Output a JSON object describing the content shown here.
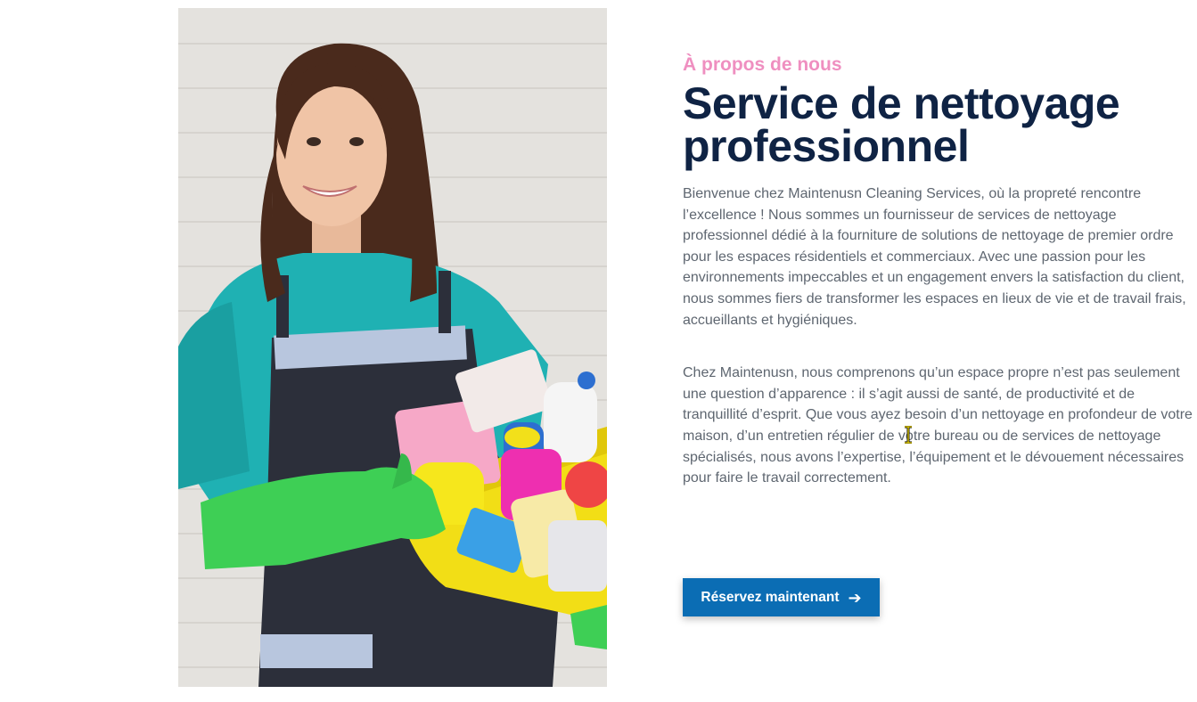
{
  "photo": {
    "alt_icon": "cleaning-lady-photo"
  },
  "about": {
    "eyebrow": "À propos de nous",
    "title_line1": "Service de nettoyage",
    "title_line2": "professionnel",
    "paragraph1": "Bienvenue chez Maintenusn Cleaning Services, où la propreté rencontre l’excellence ! Nous sommes un fournisseur de services de nettoyage professionnel dédié à la fourniture de solutions de nettoyage de premier ordre pour les espaces résidentiels et commerciaux. Avec une passion pour les environnements impeccables et un engagement envers la satisfaction du client, nous sommes fiers de transformer les espaces en lieux de vie et de travail frais, accueillants et hygiéniques.",
    "paragraph2": "Chez Maintenusn, nous comprenons qu’un espace propre n’est pas seulement une question d’apparence : il s’agit aussi de santé, de productivité et de tranquillité d’esprit. Que vous ayez besoin d’un nettoyage en profondeur de votre maison, d’un entretien régulier de votre bureau ou de services de nettoyage spécialisés, nous avons l’expertise, l’équipement et le dévouement nécessaires pour faire le travail correctement."
  },
  "cta": {
    "label": "Réservez maintenant",
    "icon": "arrow-right-icon",
    "arrow": "➔"
  },
  "colors": {
    "eyebrow": "#ef8fc0",
    "title": "#0f2344",
    "button": "#0b6db4"
  }
}
